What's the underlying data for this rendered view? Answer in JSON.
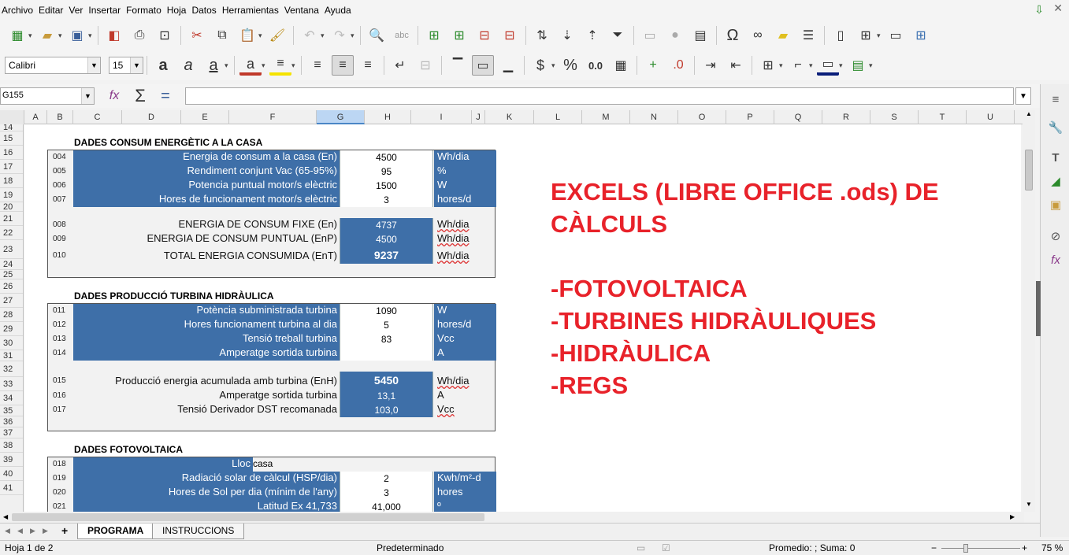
{
  "menu": [
    "Archivo",
    "Editar",
    "Ver",
    "Insertar",
    "Formato",
    "Hoja",
    "Datos",
    "Herramientas",
    "Ventana",
    "Ayuda"
  ],
  "toolbar": {
    "font_name": "Calibri",
    "font_size": "15",
    "percent": "%",
    "decimal": "0.0",
    "currency": "$",
    "omega": "Ω"
  },
  "formula_bar": {
    "cell_ref": "G155",
    "content": "",
    "fx": "fx",
    "sum": "Σ",
    "equals": "="
  },
  "columns": [
    "A",
    "B",
    "C",
    "D",
    "E",
    "F",
    "G",
    "H",
    "I",
    "J",
    "K",
    "L",
    "M",
    "N",
    "O",
    "P",
    "Q",
    "R",
    "S",
    "T",
    "U"
  ],
  "selected_column": "G",
  "rows": [
    "14",
    "15",
    "16",
    "17",
    "18",
    "19",
    "20",
    "21",
    "22",
    "23",
    "24",
    "25",
    "26",
    "27",
    "28",
    "29",
    "30",
    "31",
    "32",
    "33",
    "34",
    "35",
    "36",
    "37",
    "38",
    "39",
    "40",
    "41"
  ],
  "sections": {
    "consum": {
      "title": "DADES CONSUM ENERGÈTIC A LA CASA",
      "rows": [
        {
          "code": "004",
          "label": "Energia de consum a la casa (En)",
          "value": "4500",
          "unit": "Wh/dia"
        },
        {
          "code": "005",
          "label": "Rendiment  conjunt Vac (65-95%)",
          "value": "95",
          "unit": "%"
        },
        {
          "code": "006",
          "label": "Potencia puntual  motor/s elèctric",
          "value": "1500",
          "unit": "W"
        },
        {
          "code": "007",
          "label": "Hores de funcionament motor/s elèctric",
          "value": "3",
          "unit": "hores/d"
        },
        {
          "code": "008",
          "label": "ENERGIA DE CONSUM FIXE (En)",
          "value": "4737",
          "unit": "Wh/dia"
        },
        {
          "code": "009",
          "label": "ENERGIA DE CONSUM PUNTUAL (EnP)",
          "value": "4500",
          "unit": "Wh/dia"
        },
        {
          "code": "010",
          "label": "TOTAL ENERGIA CONSUMIDA (EnT)",
          "value": "9237",
          "unit": "Wh/dia"
        }
      ]
    },
    "turbina": {
      "title": "DADES PRODUCCIÓ TURBINA HIDRÀULICA",
      "rows": [
        {
          "code": "011",
          "label": "Potència subministrada turbina",
          "value": "1090",
          "unit": "W"
        },
        {
          "code": "012",
          "label": "Hores funcionament turbina al dia",
          "value": "5",
          "unit": "hores/d"
        },
        {
          "code": "013",
          "label": "Tensió treball turbina",
          "value": "83",
          "unit": "Vcc"
        },
        {
          "code": "014",
          "label": "Amperatge sortida turbina",
          "value": "",
          "unit": "A"
        },
        {
          "code": "015",
          "label": "Producció energia acumulada  amb turbina (EnH)",
          "value": "5450",
          "unit": "Wh/dia"
        },
        {
          "code": "016",
          "label": "Amperatge sortida turbina",
          "value": "13,1",
          "unit": "A"
        },
        {
          "code": "017",
          "label": "Tensió Derivador DST recomanada",
          "value": "103,0",
          "unit": "Vcc"
        }
      ]
    },
    "foto": {
      "title": "DADES FOTOVOLTAICA",
      "rows": [
        {
          "code": "018",
          "label": "Lloc",
          "value": "casa",
          "unit": ""
        },
        {
          "code": "019",
          "label": "Radiació solar de càlcul (HSP/dia)",
          "value": "2",
          "unit": "Kwh/m²-d"
        },
        {
          "code": "020",
          "label": "Hores de Sol per dia (mínim de l'any)",
          "value": "3",
          "unit": "hores"
        },
        {
          "code": "021",
          "label": "Latitud Ex 41,733",
          "value": "41,000",
          "unit": "º"
        }
      ]
    }
  },
  "overlay_text": "EXCELS (LIBRE OFFICE .ods) DE\nCÀLCULS\n\n-FOTOVOLTAICA\n-TURBINES HIDRÀULIQUES\n-HIDRÀULICA\n-REGS",
  "sheet_tabs": {
    "add": "+",
    "tabs": [
      "PROGRAMA",
      "INSTRUCCIONS"
    ],
    "active": "PROGRAMA"
  },
  "status": {
    "sheet": "Hoja 1 de 2",
    "style": "Predeterminado",
    "sum": "Promedio: ; Suma: 0",
    "zoom": "75 %"
  },
  "colors": {
    "blue_fill": "#3e6fa8",
    "overlay_red": "#e8222a"
  }
}
